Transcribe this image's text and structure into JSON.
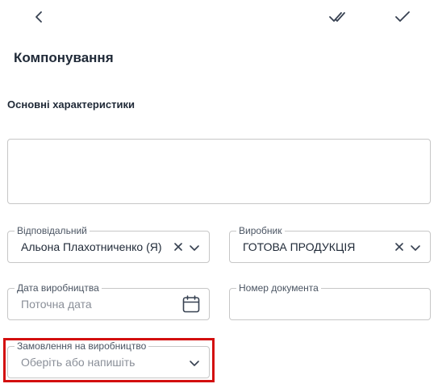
{
  "header": {
    "title": "Компонування",
    "icons": [
      "chevron-left-icon",
      "double-check-icon",
      "check-icon"
    ]
  },
  "section": {
    "title": "Основні характеристики"
  },
  "fields": {
    "responsible": {
      "label": "Відповідальний",
      "value": "Альона Плахотниченко (Я)"
    },
    "manufacturer": {
      "label": "Виробник",
      "value": "ГОТОВА ПРОДУКЦІЯ"
    },
    "production_date": {
      "label": "Дата виробництва",
      "placeholder": "Поточна дата"
    },
    "document_number": {
      "label": "Номер документа",
      "value": ""
    },
    "production_order": {
      "label": "Замовлення на виробництво",
      "placeholder": "Оберіть або напишіть"
    }
  },
  "colors": {
    "highlight": "#d30f0f",
    "border": "#c7c7c7",
    "text": "#1f2937",
    "placeholder": "#8a8f98"
  }
}
